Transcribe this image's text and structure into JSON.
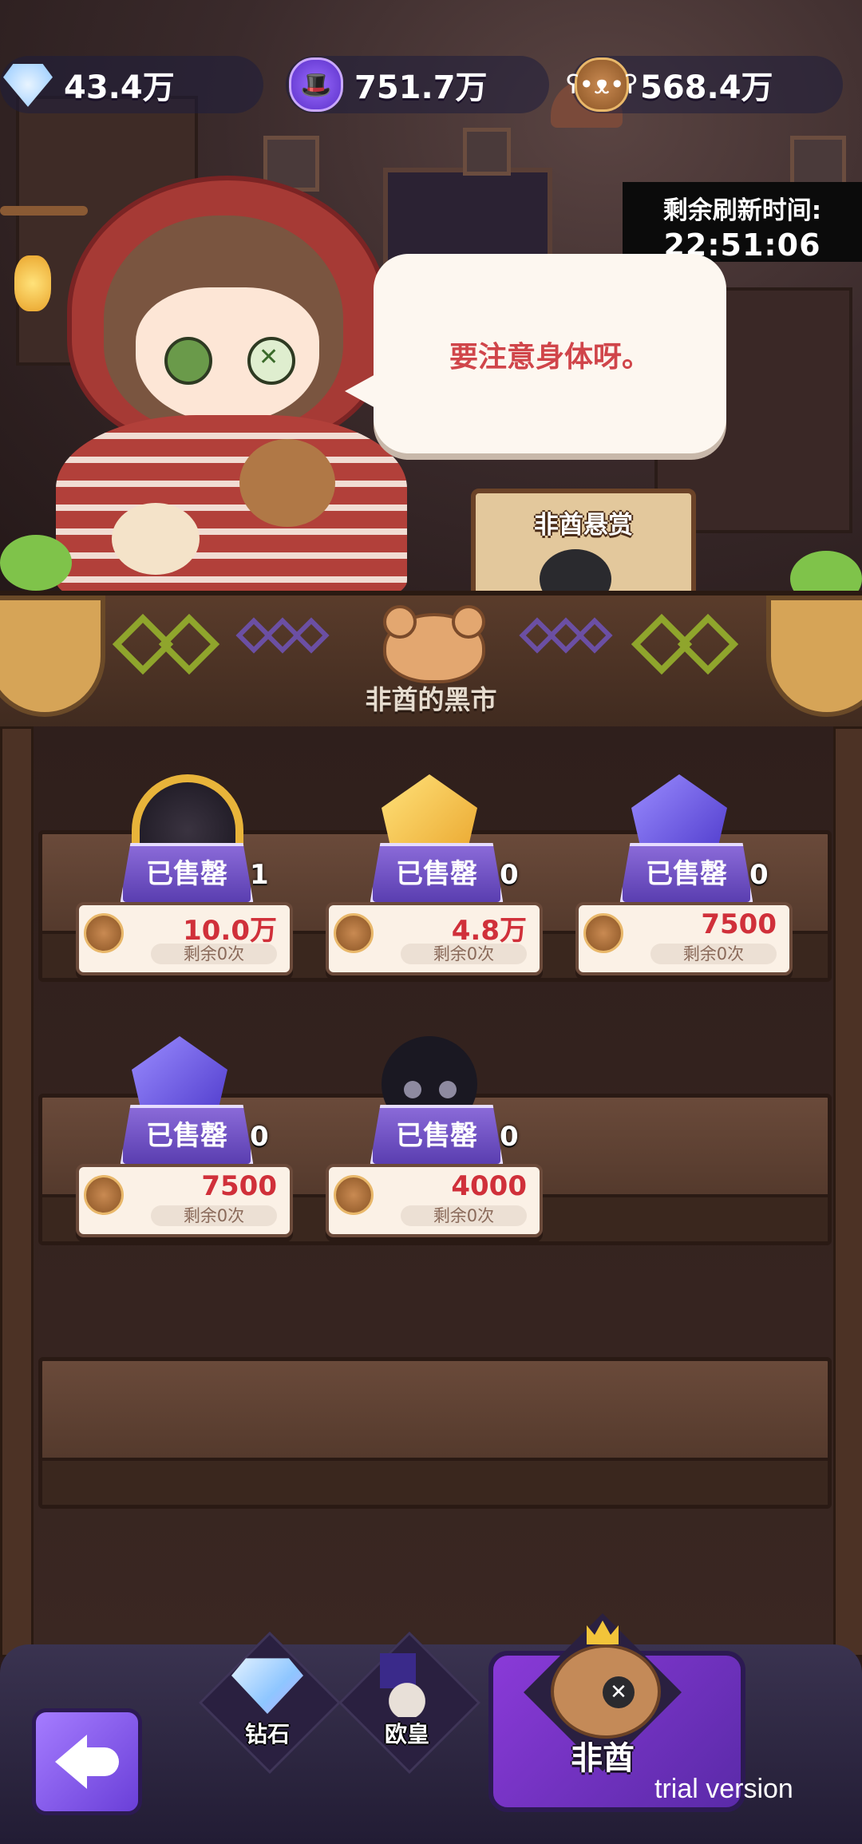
{
  "resources": [
    {
      "icon": "diamond-icon",
      "value": "43.4万"
    },
    {
      "icon": "top-hat-icon",
      "value": "751.7万"
    },
    {
      "icon": "bear-coin-icon",
      "value": "568.4万"
    }
  ],
  "refresh": {
    "label": "剩余刷新时间:",
    "time": "22:51:06"
  },
  "speech": "要注意身体呀。",
  "bounty_sign": "非酋悬赏",
  "market_title": "非酋的黑市",
  "items": [
    {
      "art": "gold-frame",
      "sold_label": "已售罄",
      "qty": "1",
      "price": "10.0万",
      "remaining": "剩余0次"
    },
    {
      "art": "gold-crystal",
      "sold_label": "已售罄",
      "qty": "0",
      "price": "4.8万",
      "remaining": "剩余0次"
    },
    {
      "art": "purple-crystal",
      "sold_label": "已售罄",
      "qty": "0",
      "price": "7500",
      "remaining": "剩余0次"
    },
    {
      "art": "purple-crystal",
      "sold_label": "已售罄",
      "qty": "0",
      "price": "7500",
      "remaining": "剩余0次"
    },
    {
      "art": "dark-blob",
      "sold_label": "已售罄",
      "qty": "0",
      "price": "4000",
      "remaining": "剩余0次"
    }
  ],
  "nav": {
    "tabs": [
      {
        "label": "钻石",
        "icon": "diamond-icon"
      },
      {
        "label": "欧皇",
        "icon": "top-hat-icon"
      },
      {
        "label": "非酋",
        "icon": "bear-crown-icon",
        "active": true
      }
    ]
  },
  "watermark": "trial version",
  "colors": {
    "price_red": "#d0303a",
    "sold_purple": "#6a4ac8",
    "speech_red": "#d0454a"
  }
}
